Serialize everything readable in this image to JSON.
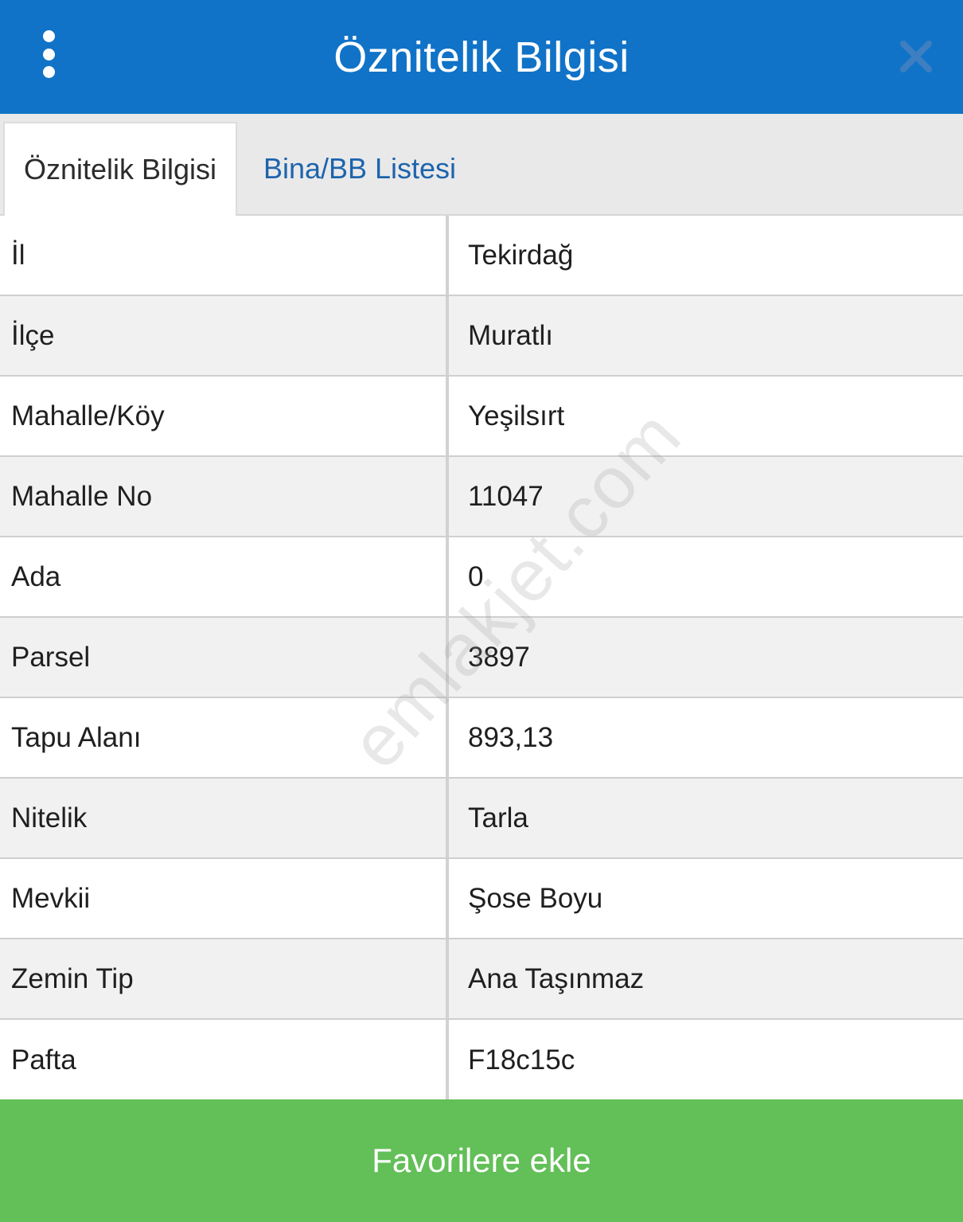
{
  "header": {
    "title": "Öznitelik Bilgisi",
    "menu_icon": "kebab-menu-icon",
    "close_icon": "close-icon"
  },
  "tabs": [
    {
      "label": "Öznitelik Bilgisi",
      "active": true
    },
    {
      "label": "Bina/BB Listesi",
      "active": false
    }
  ],
  "attributes": [
    {
      "key": "İl",
      "value": "Tekirdağ"
    },
    {
      "key": "İlçe",
      "value": "Muratlı"
    },
    {
      "key": "Mahalle/Köy",
      "value": "Yeşilsırt"
    },
    {
      "key": "Mahalle No",
      "value": "11047"
    },
    {
      "key": "Ada",
      "value": "0"
    },
    {
      "key": "Parsel",
      "value": "3897"
    },
    {
      "key": "Tapu Alanı",
      "value": "893,13"
    },
    {
      "key": "Nitelik",
      "value": "Tarla"
    },
    {
      "key": "Mevkii",
      "value": "Şose Boyu"
    },
    {
      "key": "Zemin Tip",
      "value": "Ana Taşınmaz"
    },
    {
      "key": "Pafta",
      "value": "F18c15c"
    }
  ],
  "watermark": "emlakjet.com",
  "footer": {
    "button_label": "Favorilere ekle"
  },
  "colors": {
    "header_bg": "#1173c7",
    "tab_link": "#1d64ac",
    "button_bg": "#63bf58"
  }
}
